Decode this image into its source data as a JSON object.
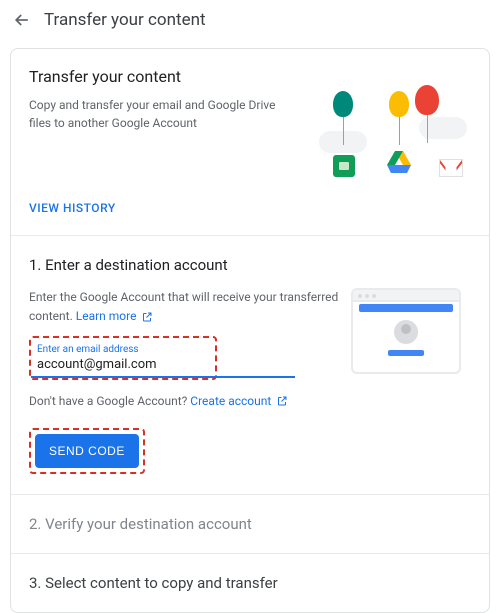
{
  "header": {
    "title": "Transfer your content"
  },
  "intro": {
    "title": "Transfer your content",
    "desc": "Copy and transfer your email and Google Drive files to another Google Account",
    "view_history_label": "VIEW HISTORY"
  },
  "step1": {
    "title": "1. Enter a destination account",
    "desc": "Enter the Google Account that will receive your transferred content.",
    "learn_more": "Learn more",
    "field_label": "Enter an email address",
    "field_value": "account@gmail.com",
    "no_account_text": "Don't have a Google Account?",
    "create_account": "Create account",
    "send_code_label": "SEND CODE"
  },
  "step2": {
    "title": "2. Verify your destination account"
  },
  "step3": {
    "title": "3. Select content to copy and transfer"
  },
  "colors": {
    "accent": "#1a73e8",
    "highlight_border": "#d93025"
  }
}
